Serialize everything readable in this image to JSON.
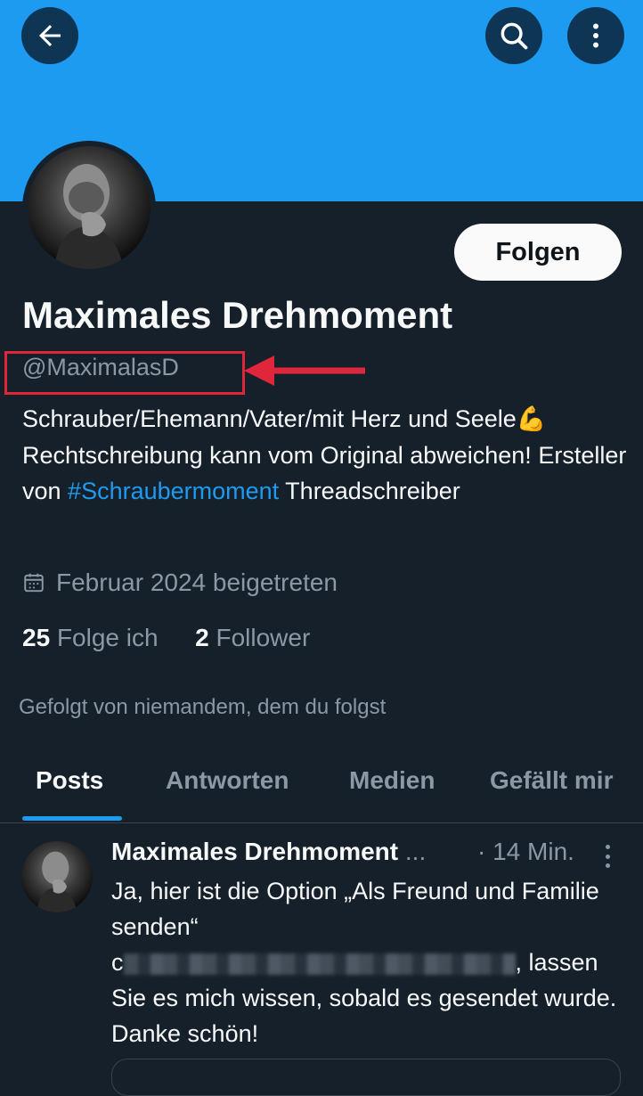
{
  "header": {
    "back_icon": "arrow-left-icon",
    "search_icon": "search-icon",
    "more_icon": "more-vertical-icon"
  },
  "profile": {
    "display_name": "Maximales Drehmoment",
    "handle": "@MaximalasD",
    "follow_label": "Folgen",
    "bio_text": "Schrauber/Ehemann/Vater/mit Herz und Seele💪 Rechtschreibung kann vom Original abweichen! Ersteller von ",
    "bio_hashtag": "#Schraubermoment",
    "bio_after": " Threadschreiber",
    "joined": "Februar 2024 beigetreten",
    "following_count": "25",
    "following_label": "Folge ich",
    "followers_count": "2",
    "followers_label": "Follower",
    "followed_by": "Gefolgt von niemandem, dem du folgst"
  },
  "tabs": [
    {
      "label": "Posts",
      "active": true
    },
    {
      "label": "Antworten"
    },
    {
      "label": "Medien"
    },
    {
      "label": "Gefällt mir"
    }
  ],
  "post": {
    "author": "Maximales Drehmoment",
    "ellipsis": " ...",
    "time": "· 14 Min.",
    "text_1": "Ja, hier ist die Option „Als Freund und Familie senden“",
    "text_blur_prefix": "c",
    "text_blur_suffix": ", lassen",
    "text_2": "Sie es mich wissen, sobald es gesendet wurde. Danke schön!"
  },
  "colors": {
    "accent": "#1d9bf0",
    "background": "#15202b",
    "annotation": "#e0263a"
  }
}
